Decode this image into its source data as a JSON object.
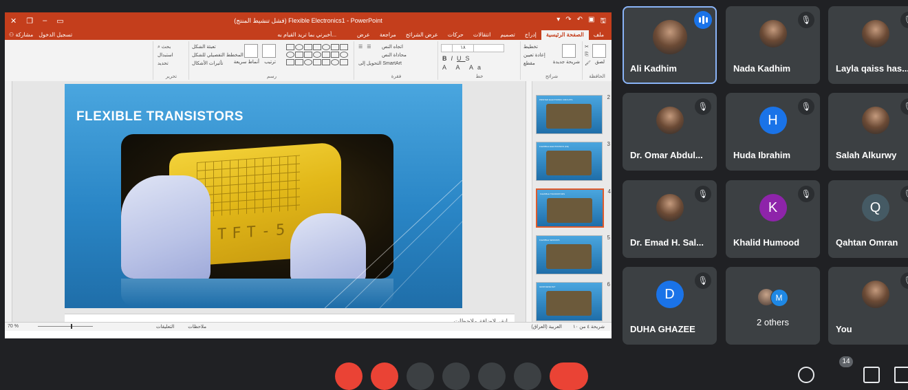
{
  "ppt": {
    "window_title": "(فشل تنشيط المنتج) Flexible Electronics1 - PowerPoint",
    "tell_me": "أخبرني بما تريد القيام به...",
    "signin": "تسجيل الدخول",
    "share": "مشاركة",
    "tabs": [
      "ملف",
      "الصفحة الرئيسية",
      "إدراج",
      "تصميم",
      "انتقالات",
      "حركات",
      "عرض الشرائح",
      "مراجعة",
      "عرض"
    ],
    "active_tab": "الصفحة الرئيسية",
    "ribbon": {
      "paste": "لصق",
      "new_slide": "شريحة جديدة",
      "layout": "تخطيط",
      "reset": "إعادة تعيين",
      "section": "مقطع",
      "font_size": "١٨",
      "text_direction": "اتجاه النص",
      "align_text": "محاذاة النص",
      "smartart": "التحويل إلى SmartArt",
      "arrange": "ترتيب",
      "quick_styles": "أنماط سريعة",
      "shape_fill": "تعبئة الشكل",
      "shape_outline": "المخطط التفصيلي للشكل",
      "shape_effects": "تأثيرات الأشكال",
      "find": "بحث",
      "replace": "استبدال",
      "select": "تحديد",
      "groups": {
        "clipboard": "الحافظة",
        "slides": "شرائح",
        "font": "خط",
        "paragraph": "فقرة",
        "drawing": "رسم",
        "editing": "تحرير"
      }
    },
    "slide": {
      "title": "FLEXIBLE TRANSISTORS",
      "photo_text": "TFT-5"
    },
    "notes_placeholder": "انقر لإضافة ملاحظات",
    "thumbnails": [
      {
        "num": "2",
        "title": "PRINTED ELECTRONIC CIRCUITS"
      },
      {
        "num": "3",
        "title": "FLEXIBLE ELECTRONICS (FE)"
      },
      {
        "num": "4",
        "title": "FLEXIBLE TRANSISTORS"
      },
      {
        "num": "5",
        "title": "FLEXIBLE SENSORS"
      },
      {
        "num": "6",
        "title": "GRAPHENE FET"
      }
    ],
    "status": {
      "zoom": "70 %",
      "slide_of": "شريحة ٤ من ١٠",
      "language": "العربية (العراق)",
      "notes": "ملاحظات",
      "comments": "التعليقات"
    }
  },
  "participants": [
    {
      "name": "Ali Kadhim",
      "type": "photo",
      "state": "speaking"
    },
    {
      "name": "Nada Kadhim",
      "type": "photo",
      "state": "muted"
    },
    {
      "name": "Layla qaiss has...",
      "type": "photo",
      "state": "muted"
    },
    {
      "name": "Dr. Omar Abdul...",
      "type": "photo",
      "state": "muted"
    },
    {
      "name": "Huda Ibrahim",
      "type": "initial",
      "initial": "H",
      "color": "#1a73e8",
      "state": "muted"
    },
    {
      "name": "Salah Alkurwy",
      "type": "photo",
      "state": "muted"
    },
    {
      "name": "Dr. Emad H. Sal...",
      "type": "photo",
      "state": "muted"
    },
    {
      "name": "Khalid Humood",
      "type": "initial",
      "initial": "K",
      "color": "#8e24aa",
      "state": "muted"
    },
    {
      "name": "Qahtan Omran",
      "type": "initial",
      "initial": "Q",
      "color": "#455a64",
      "state": "muted"
    },
    {
      "name": "DUHA GHAZEE",
      "type": "initial",
      "initial": "D",
      "color": "#1a73e8",
      "state": "muted"
    },
    {
      "name": "2 others",
      "type": "group",
      "initial": "M",
      "color": "#1e88e5"
    },
    {
      "name": "You",
      "type": "photo",
      "state": "muted"
    }
  ],
  "controls": {
    "participants_badge": "14"
  },
  "colors": {
    "ppt_accent": "#c43e1c",
    "meet_bg": "#202124",
    "tile_bg": "#3c4043",
    "speaking_outline": "#8ab4f8",
    "end_call": "#ea4335"
  }
}
